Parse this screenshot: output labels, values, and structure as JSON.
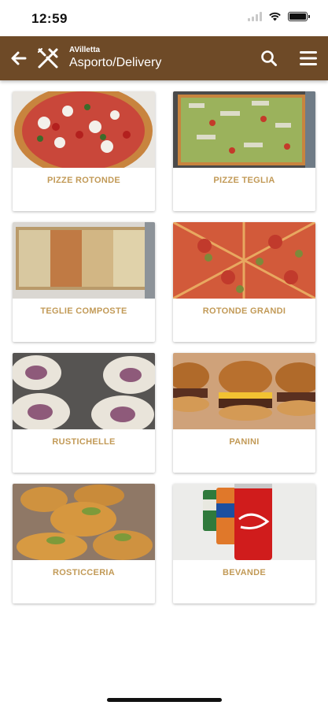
{
  "status_bar": {
    "time": "12:59"
  },
  "header": {
    "subtitle": "AVilletta",
    "title": "Asporto/Delivery",
    "back_icon": "arrow-left-icon",
    "logo_icon": "fork-knife-icon",
    "search_icon": "search-icon",
    "menu_icon": "hamburger-menu-icon"
  },
  "categories": [
    {
      "label": "PIZZE ROTONDE",
      "image": "round-pizza-photo"
    },
    {
      "label": "PIZZE TEGLIA",
      "image": "tray-pizza-photo"
    },
    {
      "label": "TEGLIE COMPOSTE",
      "image": "composite-tray-photo"
    },
    {
      "label": "ROTONDE GRANDI",
      "image": "large-round-pizza-photo"
    },
    {
      "label": "RUSTICHELLE",
      "image": "rustichelle-photo"
    },
    {
      "label": "PANINI",
      "image": "burger-photo"
    },
    {
      "label": "ROSTICCERIA",
      "image": "arancini-photo"
    },
    {
      "label": "BEVANDE",
      "image": "soda-cans-photo"
    }
  ],
  "colors": {
    "header_bg": "#6e4a27",
    "label_text": "#c29a57",
    "status_text": "#111111"
  }
}
